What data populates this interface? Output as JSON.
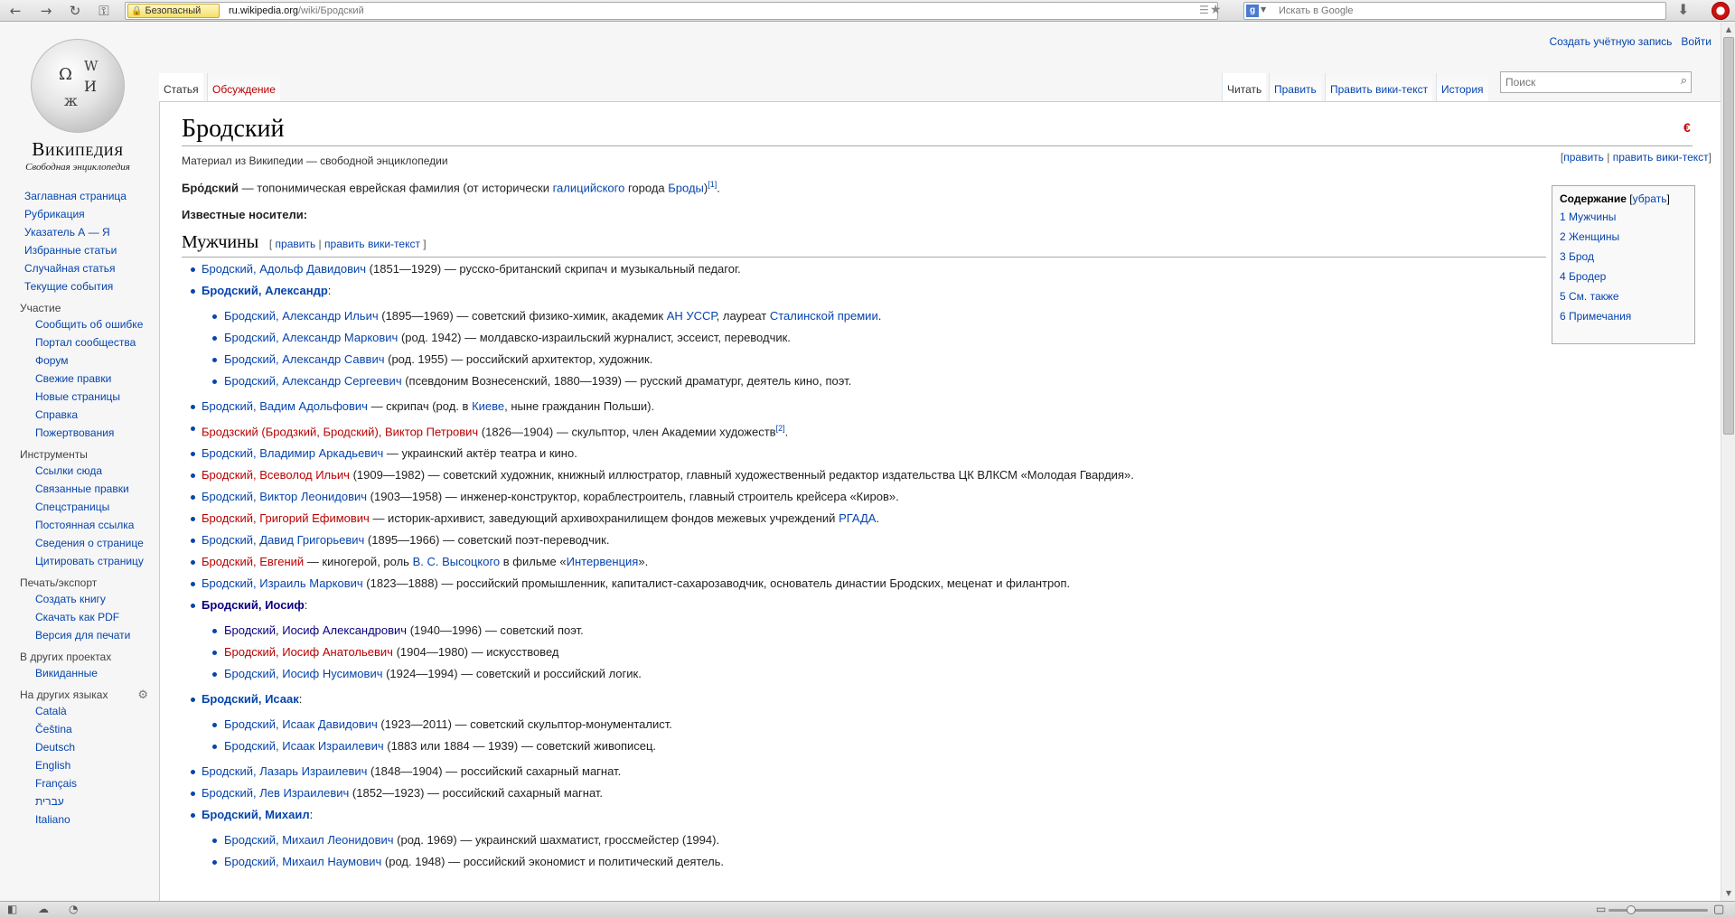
{
  "browser": {
    "security_label": "Безопасный",
    "url_host": "ru.wikipedia.org",
    "url_path": "/wiki/Бродский",
    "search_placeholder": "Искать в Google",
    "search_engine_icon": "google-icon"
  },
  "wiki": {
    "logo_title": "Википедия",
    "logo_subtitle": "Свободная энциклопедия",
    "personal": [
      "Создать учётную запись",
      "Войти"
    ],
    "tabs": {
      "article": "Статья",
      "talk": "Обсуждение",
      "read": "Читать",
      "edit": "Править",
      "edit_source": "Править вики-текст",
      "history": "История"
    },
    "search_placeholder": "Поиск"
  },
  "sidebar": {
    "main": [
      "Заглавная страница",
      "Рубрикация",
      "Указатель А — Я",
      "Избранные статьи",
      "Случайная статья",
      "Текущие события"
    ],
    "participation": {
      "heading": "Участие",
      "items": [
        "Сообщить об ошибке",
        "Портал сообщества",
        "Форум",
        "Свежие правки",
        "Новые страницы",
        "Справка",
        "Пожертвования"
      ]
    },
    "tools": {
      "heading": "Инструменты",
      "items": [
        "Ссылки сюда",
        "Связанные правки",
        "Спецстраницы",
        "Постоянная ссылка",
        "Сведения о странице",
        "Цитировать страницу"
      ]
    },
    "print": {
      "heading": "Печать/экспорт",
      "items": [
        "Создать книгу",
        "Скачать как PDF",
        "Версия для печати"
      ]
    },
    "projects": {
      "heading": "В других проектах",
      "items": [
        "Викиданные"
      ]
    },
    "languages": {
      "heading": "На других языках",
      "items": [
        "Català",
        "Čeština",
        "Deutsch",
        "English",
        "Français",
        "עברית",
        "Italiano"
      ]
    }
  },
  "article": {
    "title": "Бродский",
    "tagline": "Материал из Википедии — свободной энциклопедии",
    "top_edit": {
      "edit": "править",
      "edit_source": "править вики-текст"
    },
    "lead": {
      "bold": "Бро́дский",
      "t1": " — топонимическая еврейская фамилия (от исторически ",
      "link1": "галицийского",
      "t2": " города ",
      "link2": "Броды",
      "t3": ")",
      "ref": "[1]",
      "t4": "."
    },
    "known": "Известные носители:",
    "toc": {
      "title": "Содержание",
      "toggle": "убрать",
      "items": [
        "1 Мужчины",
        "2 Женщины",
        "3 Брод",
        "4 Бродер",
        "5 См. также",
        "6 Примечания"
      ]
    },
    "section": {
      "title": "Мужчины",
      "edit": "править",
      "edit_source": "править вики-текст"
    },
    "entries": [
      {
        "level": 0,
        "parts": [
          {
            "link": "Бродский, Адольф Давидович"
          },
          {
            "text": " (1851—1929) — русско-британский скрипач и музыкальный педагог."
          }
        ]
      },
      {
        "level": 0,
        "parent": true,
        "parts": [
          {
            "link": "Бродский, Александр",
            "style": "bold"
          },
          {
            "text": ":"
          }
        ]
      },
      {
        "level": 1,
        "parts": [
          {
            "link": "Бродский, Александр Ильич"
          },
          {
            "text": " (1895—1969) — советский физико-химик, академик "
          },
          {
            "link": "АН УССР"
          },
          {
            "text": ", лауреат "
          },
          {
            "link": "Сталинской премии"
          },
          {
            "text": "."
          }
        ]
      },
      {
        "level": 1,
        "parts": [
          {
            "link": "Бродский, Александр Маркович"
          },
          {
            "text": " (род. 1942) — молдавско-израильский журналист, эссеист, переводчик."
          }
        ]
      },
      {
        "level": 1,
        "parts": [
          {
            "link": "Бродский, Александр Саввич"
          },
          {
            "text": " (род. 1955) — российский архитектор, художник."
          }
        ]
      },
      {
        "level": 1,
        "lastsub": true,
        "parts": [
          {
            "link": "Бродский, Александр Сергеевич"
          },
          {
            "text": " (псевдоним Вознесенский, 1880—1939) — русский драматург, деятель кино, поэт."
          }
        ]
      },
      {
        "level": 0,
        "parts": [
          {
            "link": "Бродский, Вадим Адольфович"
          },
          {
            "text": " — скрипач (род. в "
          },
          {
            "link": "Киеве"
          },
          {
            "text": ", ныне гражданин Польши)."
          }
        ]
      },
      {
        "level": 0,
        "parts": [
          {
            "link": "Бродзский (Бродзкий, Бродский), Виктор Петрович",
            "style": "red"
          },
          {
            "text": " (1826—1904) — скульптор, член Академии художеств"
          },
          {
            "ref": "[2]"
          },
          {
            "text": "."
          }
        ]
      },
      {
        "level": 0,
        "parts": [
          {
            "link": "Бродский, Владимир Аркадьевич"
          },
          {
            "text": " — украинский актёр театра и кино."
          }
        ]
      },
      {
        "level": 0,
        "parts": [
          {
            "link": "Бродский, Всеволод Ильич",
            "style": "red"
          },
          {
            "text": " (1909—1982) — советский художник, книжный иллюстратор, главный художественный редактор издательства ЦК ВЛКСМ «Молодая Гвардия»."
          }
        ]
      },
      {
        "level": 0,
        "parts": [
          {
            "link": "Бродский, Виктор Леонидович"
          },
          {
            "text": " (1903—1958) — инженер-конструктор, кораблестроитель, главный строитель крейсера «Киров»."
          }
        ]
      },
      {
        "level": 0,
        "parts": [
          {
            "link": "Бродский, Григорий Ефимович",
            "style": "red"
          },
          {
            "text": " — историк-архивист, заведующий архивохранилищем фондов межевых учреждений "
          },
          {
            "link": "РГАДА"
          },
          {
            "text": "."
          }
        ]
      },
      {
        "level": 0,
        "parts": [
          {
            "link": "Бродский, Давид Григорьевич"
          },
          {
            "text": " (1895—1966) — советский поэт-переводчик."
          }
        ]
      },
      {
        "level": 0,
        "parts": [
          {
            "link": "Бродский, Евгений",
            "style": "red"
          },
          {
            "text": " — киногерой, роль "
          },
          {
            "link": "В. С. Высоцкого"
          },
          {
            "text": " в фильме «"
          },
          {
            "link": "Интервенция"
          },
          {
            "text": "»."
          }
        ]
      },
      {
        "level": 0,
        "parts": [
          {
            "link": "Бродский, Израиль Маркович"
          },
          {
            "text": " (1823—1888) — российский промышленник, капиталист-сахарозаводчик, основатель династии Бродских, меценат и филантроп."
          }
        ]
      },
      {
        "level": 0,
        "parent": true,
        "parts": [
          {
            "link": "Бродский, Иосиф",
            "style": "bold visited"
          },
          {
            "text": ":"
          }
        ]
      },
      {
        "level": 1,
        "parts": [
          {
            "link": "Бродский, Иосиф Александрович",
            "style": "visited"
          },
          {
            "text": " (1940—1996) — советский поэт."
          }
        ]
      },
      {
        "level": 1,
        "parts": [
          {
            "link": "Бродский, Иосиф Анатольевич",
            "style": "red"
          },
          {
            "text": " (1904—1980) — искусствовед"
          }
        ]
      },
      {
        "level": 1,
        "lastsub": true,
        "parts": [
          {
            "link": "Бродский, Иосиф Нусимович"
          },
          {
            "text": " (1924—1994) — советский и российский логик."
          }
        ]
      },
      {
        "level": 0,
        "parent": true,
        "parts": [
          {
            "link": "Бродский, Исаак",
            "style": "bold"
          },
          {
            "text": ":"
          }
        ]
      },
      {
        "level": 1,
        "parts": [
          {
            "link": "Бродский, Исаак Давидович"
          },
          {
            "text": " (1923—2011) — советский скульптор-монументалист."
          }
        ]
      },
      {
        "level": 1,
        "lastsub": true,
        "parts": [
          {
            "link": "Бродский, Исаак Израилевич"
          },
          {
            "text": " (1883 или 1884 — 1939) — советский живописец."
          }
        ]
      },
      {
        "level": 0,
        "parts": [
          {
            "link": "Бродский, Лазарь Израилевич"
          },
          {
            "text": " (1848—1904) — российский сахарный магнат."
          }
        ]
      },
      {
        "level": 0,
        "parts": [
          {
            "link": "Бродский, Лев Израилевич"
          },
          {
            "text": " (1852—1923) — российский сахарный магнат."
          }
        ]
      },
      {
        "level": 0,
        "parent": true,
        "parts": [
          {
            "link": "Бродский, Михаил",
            "style": "bold"
          },
          {
            "text": ":"
          }
        ]
      },
      {
        "level": 1,
        "parts": [
          {
            "link": "Бродский, Михаил Леонидович"
          },
          {
            "text": " (род. 1969) — украинский шахматист, гроссмейстер (1994)."
          }
        ]
      },
      {
        "level": 1,
        "parts": [
          {
            "link": "Бродский, Михаил Наумович"
          },
          {
            "text": " (род. 1948) — российский экономист и политический деятель."
          }
        ]
      }
    ]
  }
}
